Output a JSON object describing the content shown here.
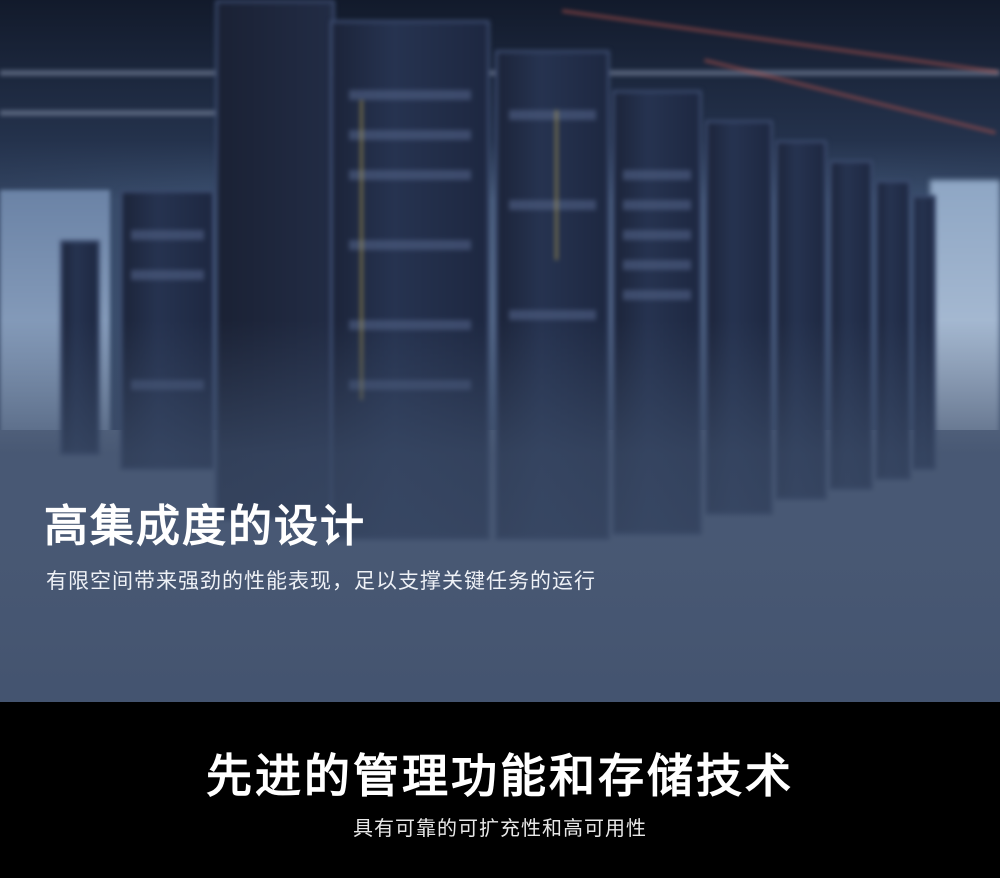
{
  "hero": {
    "title": "高集成度的设计",
    "subtitle": "有限空间带来强劲的性能表现，足以支撑关键任务的运行"
  },
  "feature": {
    "title": "先进的管理功能和存储技术",
    "subtitle": "具有可靠的可扩充性和高可用性"
  }
}
